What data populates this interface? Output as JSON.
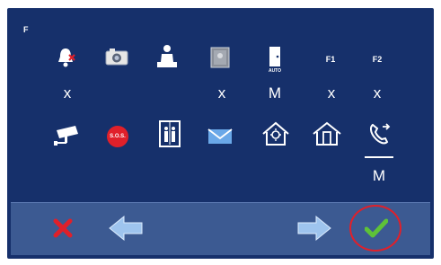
{
  "corner_label": "F",
  "top_row": [
    {
      "icon": "mute-bell-icon",
      "mark": "x"
    },
    {
      "icon": "camera-icon",
      "mark": ""
    },
    {
      "icon": "doorman-icon",
      "mark": ""
    },
    {
      "icon": "photo-icon",
      "mark": "x"
    },
    {
      "icon": "auto-door-icon",
      "sub": "AUTO",
      "mark": "M"
    },
    {
      "icon": "f1-key",
      "label": "F1",
      "mark": "x"
    },
    {
      "icon": "f2-key",
      "label": "F2",
      "mark": "x"
    }
  ],
  "bottom_row": [
    {
      "icon": "cctv-camera-icon"
    },
    {
      "icon": "sos-icon",
      "label": "S.O.S."
    },
    {
      "icon": "elevator-icon"
    },
    {
      "icon": "envelope-icon"
    },
    {
      "icon": "home-light-icon"
    },
    {
      "icon": "home-door-icon"
    },
    {
      "icon": "call-transfer-icon",
      "mark": "M"
    }
  ],
  "toolbar": {
    "cancel": "cancel-x-icon",
    "back": "arrow-left-icon",
    "forward": "arrow-right-icon",
    "confirm": "checkmark-icon"
  },
  "colors": {
    "screen": "#16306b",
    "toolbar": "#3c5a92",
    "highlight": "#e0202a"
  }
}
